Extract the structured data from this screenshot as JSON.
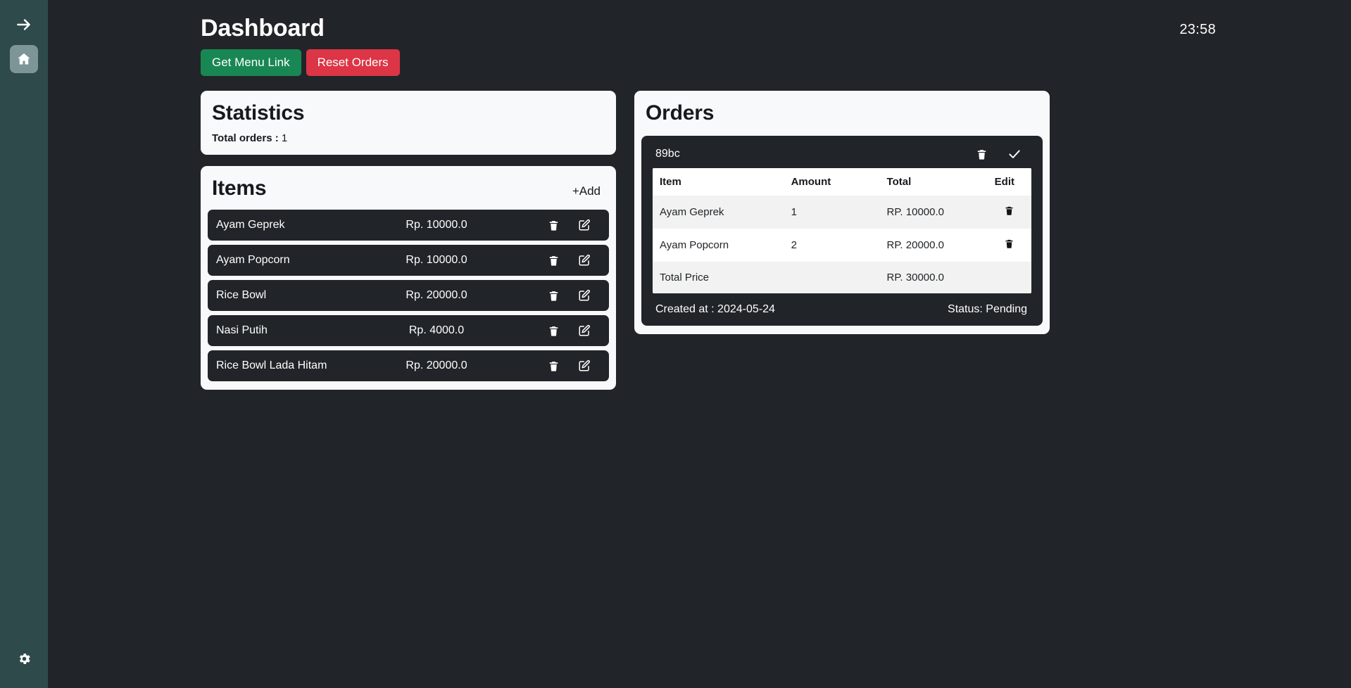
{
  "sidebar": {
    "toggle_icon": "arrow-right-icon",
    "items": [
      {
        "icon": "home-icon",
        "name": "home",
        "active": true
      }
    ],
    "bottom": {
      "icon": "gear-icon",
      "name": "settings"
    }
  },
  "header": {
    "title": "Dashboard",
    "clock": "23:58",
    "buttons": [
      {
        "label": "Get Menu Link",
        "color": "#198754"
      },
      {
        "label": "Reset Orders",
        "color": "#dc3545"
      }
    ]
  },
  "statistics": {
    "title": "Statistics",
    "total_orders_label": "Total orders :",
    "total_orders_value": "1"
  },
  "items_card": {
    "title": "Items",
    "add_label": "+Add",
    "rows": [
      {
        "name": "Ayam Geprek",
        "price": "Rp. 10000.0"
      },
      {
        "name": "Ayam Popcorn",
        "price": "Rp. 10000.0"
      },
      {
        "name": "Rice Bowl",
        "price": "Rp. 20000.0"
      },
      {
        "name": "Nasi Putih",
        "price": "Rp. 4000.0"
      },
      {
        "name": "Rice Bowl Lada Hitam",
        "price": "Rp. 20000.0"
      }
    ]
  },
  "orders_card": {
    "title": "Orders",
    "order": {
      "id": "89bc",
      "columns": [
        "Item",
        "Amount",
        "Total",
        "Edit"
      ],
      "rows": [
        {
          "item": "Ayam Geprek",
          "amount": "1",
          "total": "RP. 10000.0"
        },
        {
          "item": "Ayam Popcorn",
          "amount": "2",
          "total": "RP. 20000.0"
        }
      ],
      "total_row": {
        "item": "Total Price",
        "amount": "",
        "total": "RP. 30000.0"
      },
      "created_at": "Created at : 2024-05-24",
      "status": "Status: Pending"
    }
  },
  "colors": {
    "sidebar_bg": "#2e4a4a",
    "page_bg": "#212529",
    "card_bg": "#f8f9fa",
    "green": "#198754",
    "red": "#dc3545"
  }
}
